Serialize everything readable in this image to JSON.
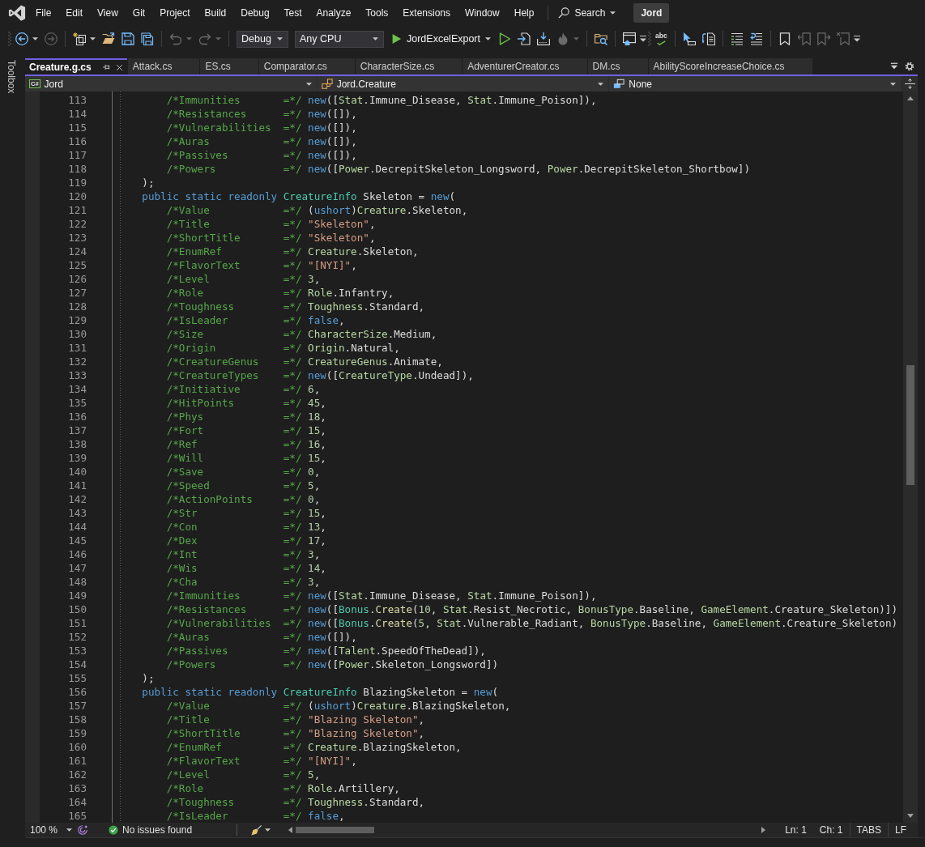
{
  "menu_bar": {
    "items": [
      "File",
      "Edit",
      "View",
      "Git",
      "Project",
      "Build",
      "Debug",
      "Test",
      "Analyze",
      "Tools",
      "Extensions",
      "Window",
      "Help"
    ],
    "search": {
      "label": "Search"
    },
    "solution": "Jord"
  },
  "toolbar": {
    "items": [
      {
        "kind": "grip"
      },
      {
        "kind": "split_button",
        "disabled": false
      },
      {
        "kind": "button",
        "disabled": true
      },
      {
        "kind": "separator"
      },
      {
        "kind": "split_button",
        "disabled": false
      },
      {
        "kind": "button",
        "disabled": false
      },
      {
        "kind": "button",
        "disabled": false
      },
      {
        "kind": "button",
        "disabled": false
      },
      {
        "kind": "separator"
      },
      {
        "kind": "split_button",
        "disabled": true
      },
      {
        "kind": "split_button",
        "disabled": true
      },
      {
        "kind": "separator"
      },
      {
        "kind": "dropdown",
        "value": "Debug"
      },
      {
        "kind": "dropdown",
        "value": "Any CPU"
      },
      {
        "kind": "run",
        "label": "JordExcelExport"
      },
      {
        "kind": "button",
        "disabled": false
      },
      {
        "kind": "button",
        "disabled": false
      },
      {
        "kind": "button",
        "disabled": false
      },
      {
        "kind": "split_button",
        "disabled": true
      },
      {
        "kind": "separator"
      },
      {
        "kind": "button",
        "disabled": false
      },
      {
        "kind": "separator"
      },
      {
        "kind": "button",
        "disabled": false
      },
      {
        "kind": "overflow"
      },
      {
        "kind": "grip"
      },
      {
        "kind": "text_button",
        "label": "abc"
      },
      {
        "kind": "separator"
      },
      {
        "kind": "button",
        "disabled": false
      },
      {
        "kind": "button",
        "disabled": false
      },
      {
        "kind": "separator"
      },
      {
        "kind": "button",
        "disabled": false
      },
      {
        "kind": "button",
        "disabled": false
      },
      {
        "kind": "separator"
      },
      {
        "kind": "button",
        "disabled": false
      },
      {
        "kind": "button",
        "disabled": true
      },
      {
        "kind": "button",
        "disabled": true
      },
      {
        "kind": "button",
        "disabled": true
      },
      {
        "kind": "overflow"
      }
    ]
  },
  "toolbox_tab": {
    "label": "Toolbox"
  },
  "tabs": [
    {
      "label": "Creature.g.cs",
      "selected": true
    },
    {
      "label": "Attack.cs",
      "selected": false
    },
    {
      "label": "ES.cs",
      "selected": false
    },
    {
      "label": "Comparator.cs",
      "selected": false
    },
    {
      "label": "CharacterSize.cs",
      "selected": false
    },
    {
      "label": "AdventurerCreator.cs",
      "selected": false
    },
    {
      "label": "DM.cs",
      "selected": false
    },
    {
      "label": "AbilityScoreIncreaseChoice.cs",
      "selected": false
    }
  ],
  "navigation": [
    {
      "icon_text": "C#",
      "value": "Jord"
    },
    {
      "value": "Jord.Creature"
    },
    {
      "value": "None"
    }
  ],
  "code": {
    "lines": [
      {
        "children": [
          {
            "number": "113",
            "tokens": [
              {
                "kind": "comment",
                "text": "/*Immunities       =*/ "
              },
              {
                "kind": "keyword",
                "text": "new"
              },
              {
                "kind": "plain",
                "text": "(["
              },
              {
                "kind": "enum",
                "text": "Stat"
              },
              {
                "kind": "plain",
                "text": ".Immune_Disease, "
              },
              {
                "kind": "enum",
                "text": "Stat"
              },
              {
                "kind": "plain",
                "text": ".Immune_Poison]),"
              }
            ]
          },
          {
            "number": "114",
            "tokens": [
              {
                "kind": "comment",
                "text": "/*Resistances      =*/ "
              },
              {
                "kind": "keyword",
                "text": "new"
              },
              {
                "kind": "plain",
                "text": "([]),"
              }
            ]
          },
          {
            "number": "115",
            "tokens": [
              {
                "kind": "comment",
                "text": "/*Vulnerabilities  =*/ "
              },
              {
                "kind": "keyword",
                "text": "new"
              },
              {
                "kind": "plain",
                "text": "([]),"
              }
            ]
          },
          {
            "number": "116",
            "tokens": [
              {
                "kind": "comment",
                "text": "/*Auras            =*/ "
              },
              {
                "kind": "keyword",
                "text": "new"
              },
              {
                "kind": "plain",
                "text": "([]),"
              }
            ]
          },
          {
            "number": "117",
            "tokens": [
              {
                "kind": "comment",
                "text": "/*Passives         =*/ "
              },
              {
                "kind": "keyword",
                "text": "new"
              },
              {
                "kind": "plain",
                "text": "([]),"
              }
            ]
          },
          {
            "number": "118",
            "tokens": [
              {
                "kind": "comment",
                "text": "/*Powers           =*/ "
              },
              {
                "kind": "keyword",
                "text": "new"
              },
              {
                "kind": "plain",
                "text": "(["
              },
              {
                "kind": "enum",
                "text": "Power"
              },
              {
                "kind": "plain",
                "text": ".DecrepitSkeleton_Longsword, "
              },
              {
                "kind": "enum",
                "text": "Power"
              },
              {
                "kind": "plain",
                "text": ".DecrepitSkeleton_Shortbow])"
              }
            ]
          }
        ]
      },
      {
        "number": "119",
        "tokens": [
          {
            "kind": "plain",
            "text": ");"
          }
        ]
      },
      {
        "number": "120",
        "tokens": [
          {
            "kind": "keyword",
            "text": "public static readonly "
          },
          {
            "kind": "class",
            "text": "CreatureInfo"
          },
          {
            "kind": "plain",
            "text": " Skeleton = "
          },
          {
            "kind": "keyword",
            "text": "new"
          },
          {
            "kind": "plain",
            "text": "("
          }
        ],
        "children": [
          {
            "number": "121",
            "tokens": [
              {
                "kind": "comment",
                "text": "/*Value            =*/ "
              },
              {
                "kind": "plain",
                "text": "("
              },
              {
                "kind": "keyword",
                "text": "ushort"
              },
              {
                "kind": "plain",
                "text": ")"
              },
              {
                "kind": "enum",
                "text": "Creature"
              },
              {
                "kind": "plain",
                "text": ".Skeleton,"
              }
            ]
          },
          {
            "number": "122",
            "tokens": [
              {
                "kind": "comment",
                "text": "/*Title            =*/ "
              },
              {
                "kind": "string",
                "text": "\"Skeleton\""
              },
              {
                "kind": "plain",
                "text": ","
              }
            ]
          },
          {
            "number": "123",
            "tokens": [
              {
                "kind": "comment",
                "text": "/*ShortTitle       =*/ "
              },
              {
                "kind": "string",
                "text": "\"Skeleton\""
              },
              {
                "kind": "plain",
                "text": ","
              }
            ]
          },
          {
            "number": "124",
            "tokens": [
              {
                "kind": "comment",
                "text": "/*EnumRef          =*/ "
              },
              {
                "kind": "enum",
                "text": "Creature"
              },
              {
                "kind": "plain",
                "text": ".Skeleton,"
              }
            ]
          },
          {
            "number": "125",
            "tokens": [
              {
                "kind": "comment",
                "text": "/*FlavorText       =*/ "
              },
              {
                "kind": "string",
                "text": "\"[NYI]\""
              },
              {
                "kind": "plain",
                "text": ","
              }
            ]
          },
          {
            "number": "126",
            "tokens": [
              {
                "kind": "comment",
                "text": "/*Level            =*/ "
              },
              {
                "kind": "number",
                "text": "3"
              },
              {
                "kind": "plain",
                "text": ","
              }
            ]
          },
          {
            "number": "127",
            "tokens": [
              {
                "kind": "comment",
                "text": "/*Role             =*/ "
              },
              {
                "kind": "enum",
                "text": "Role"
              },
              {
                "kind": "plain",
                "text": ".Infantry,"
              }
            ]
          },
          {
            "number": "128",
            "tokens": [
              {
                "kind": "comment",
                "text": "/*Toughness        =*/ "
              },
              {
                "kind": "enum",
                "text": "Toughness"
              },
              {
                "kind": "plain",
                "text": ".Standard,"
              }
            ]
          },
          {
            "number": "129",
            "tokens": [
              {
                "kind": "comment",
                "text": "/*IsLeader         =*/ "
              },
              {
                "kind": "keyword",
                "text": "false"
              },
              {
                "kind": "plain",
                "text": ","
              }
            ]
          },
          {
            "number": "130",
            "tokens": [
              {
                "kind": "comment",
                "text": "/*Size             =*/ "
              },
              {
                "kind": "enum",
                "text": "CharacterSize"
              },
              {
                "kind": "plain",
                "text": ".Medium,"
              }
            ]
          },
          {
            "number": "131",
            "tokens": [
              {
                "kind": "comment",
                "text": "/*Origin           =*/ "
              },
              {
                "kind": "enum",
                "text": "Origin"
              },
              {
                "kind": "plain",
                "text": ".Natural,"
              }
            ]
          },
          {
            "number": "132",
            "tokens": [
              {
                "kind": "comment",
                "text": "/*CreatureGenus    =*/ "
              },
              {
                "kind": "enum",
                "text": "CreatureGenus"
              },
              {
                "kind": "plain",
                "text": ".Animate,"
              }
            ]
          },
          {
            "number": "133",
            "tokens": [
              {
                "kind": "comment",
                "text": "/*CreatureTypes    =*/ "
              },
              {
                "kind": "keyword",
                "text": "new"
              },
              {
                "kind": "plain",
                "text": "(["
              },
              {
                "kind": "enum",
                "text": "CreatureType"
              },
              {
                "kind": "plain",
                "text": ".Undead]),"
              }
            ]
          },
          {
            "number": "134",
            "tokens": [
              {
                "kind": "comment",
                "text": "/*Initiative       =*/ "
              },
              {
                "kind": "number",
                "text": "6"
              },
              {
                "kind": "plain",
                "text": ","
              }
            ]
          },
          {
            "number": "135",
            "tokens": [
              {
                "kind": "comment",
                "text": "/*HitPoints        =*/ "
              },
              {
                "kind": "number",
                "text": "45"
              },
              {
                "kind": "plain",
                "text": ","
              }
            ]
          },
          {
            "number": "136",
            "tokens": [
              {
                "kind": "comment",
                "text": "/*Phys             =*/ "
              },
              {
                "kind": "number",
                "text": "18"
              },
              {
                "kind": "plain",
                "text": ","
              }
            ]
          },
          {
            "number": "137",
            "tokens": [
              {
                "kind": "comment",
                "text": "/*Fort             =*/ "
              },
              {
                "kind": "number",
                "text": "15"
              },
              {
                "kind": "plain",
                "text": ","
              }
            ]
          },
          {
            "number": "138",
            "tokens": [
              {
                "kind": "comment",
                "text": "/*Ref              =*/ "
              },
              {
                "kind": "number",
                "text": "16"
              },
              {
                "kind": "plain",
                "text": ","
              }
            ]
          },
          {
            "number": "139",
            "tokens": [
              {
                "kind": "comment",
                "text": "/*Will             =*/ "
              },
              {
                "kind": "number",
                "text": "15"
              },
              {
                "kind": "plain",
                "text": ","
              }
            ]
          },
          {
            "number": "140",
            "tokens": [
              {
                "kind": "comment",
                "text": "/*Save             =*/ "
              },
              {
                "kind": "number",
                "text": "0"
              },
              {
                "kind": "plain",
                "text": ","
              }
            ]
          },
          {
            "number": "141",
            "tokens": [
              {
                "kind": "comment",
                "text": "/*Speed            =*/ "
              },
              {
                "kind": "number",
                "text": "5"
              },
              {
                "kind": "plain",
                "text": ","
              }
            ]
          },
          {
            "number": "142",
            "tokens": [
              {
                "kind": "comment",
                "text": "/*ActionPoints     =*/ "
              },
              {
                "kind": "number",
                "text": "0"
              },
              {
                "kind": "plain",
                "text": ","
              }
            ]
          },
          {
            "number": "143",
            "tokens": [
              {
                "kind": "comment",
                "text": "/*Str              =*/ "
              },
              {
                "kind": "number",
                "text": "15"
              },
              {
                "kind": "plain",
                "text": ","
              }
            ]
          },
          {
            "number": "144",
            "tokens": [
              {
                "kind": "comment",
                "text": "/*Con              =*/ "
              },
              {
                "kind": "number",
                "text": "13"
              },
              {
                "kind": "plain",
                "text": ","
              }
            ]
          },
          {
            "number": "145",
            "tokens": [
              {
                "kind": "comment",
                "text": "/*Dex              =*/ "
              },
              {
                "kind": "number",
                "text": "17"
              },
              {
                "kind": "plain",
                "text": ","
              }
            ]
          },
          {
            "number": "146",
            "tokens": [
              {
                "kind": "comment",
                "text": "/*Int              =*/ "
              },
              {
                "kind": "number",
                "text": "3"
              },
              {
                "kind": "plain",
                "text": ","
              }
            ]
          },
          {
            "number": "147",
            "tokens": [
              {
                "kind": "comment",
                "text": "/*Wis              =*/ "
              },
              {
                "kind": "number",
                "text": "14"
              },
              {
                "kind": "plain",
                "text": ","
              }
            ]
          },
          {
            "number": "148",
            "tokens": [
              {
                "kind": "comment",
                "text": "/*Cha              =*/ "
              },
              {
                "kind": "number",
                "text": "3"
              },
              {
                "kind": "plain",
                "text": ","
              }
            ]
          },
          {
            "number": "149",
            "tokens": [
              {
                "kind": "comment",
                "text": "/*Immunities       =*/ "
              },
              {
                "kind": "keyword",
                "text": "new"
              },
              {
                "kind": "plain",
                "text": "(["
              },
              {
                "kind": "enum",
                "text": "Stat"
              },
              {
                "kind": "plain",
                "text": ".Immune_Disease, "
              },
              {
                "kind": "enum",
                "text": "Stat"
              },
              {
                "kind": "plain",
                "text": ".Immune_Poison]),"
              }
            ]
          },
          {
            "number": "150",
            "tokens": [
              {
                "kind": "comment",
                "text": "/*Resistances      =*/ "
              },
              {
                "kind": "keyword",
                "text": "new"
              },
              {
                "kind": "plain",
                "text": "(["
              },
              {
                "kind": "class",
                "text": "Bonus"
              },
              {
                "kind": "plain",
                "text": "."
              },
              {
                "kind": "method",
                "text": "Create"
              },
              {
                "kind": "plain",
                "text": "("
              },
              {
                "kind": "number",
                "text": "10"
              },
              {
                "kind": "plain",
                "text": ", "
              },
              {
                "kind": "enum",
                "text": "Stat"
              },
              {
                "kind": "plain",
                "text": ".Resist_Necrotic, "
              },
              {
                "kind": "enum",
                "text": "BonusType"
              },
              {
                "kind": "plain",
                "text": ".Baseline, "
              },
              {
                "kind": "enum",
                "text": "GameElement"
              },
              {
                "kind": "plain",
                "text": ".Creature_Skeleton)])"
              }
            ]
          },
          {
            "number": "151",
            "tokens": [
              {
                "kind": "comment",
                "text": "/*Vulnerabilities  =*/ "
              },
              {
                "kind": "keyword",
                "text": "new"
              },
              {
                "kind": "plain",
                "text": "(["
              },
              {
                "kind": "class",
                "text": "Bonus"
              },
              {
                "kind": "plain",
                "text": "."
              },
              {
                "kind": "method",
                "text": "Create"
              },
              {
                "kind": "plain",
                "text": "("
              },
              {
                "kind": "number",
                "text": "5"
              },
              {
                "kind": "plain",
                "text": ", "
              },
              {
                "kind": "enum",
                "text": "Stat"
              },
              {
                "kind": "plain",
                "text": ".Vulnerable_Radiant, "
              },
              {
                "kind": "enum",
                "text": "BonusType"
              },
              {
                "kind": "plain",
                "text": ".Baseline, "
              },
              {
                "kind": "enum",
                "text": "GameElement"
              },
              {
                "kind": "plain",
                "text": ".Creature_Skeleton)"
              }
            ]
          },
          {
            "number": "152",
            "tokens": [
              {
                "kind": "comment",
                "text": "/*Auras            =*/ "
              },
              {
                "kind": "keyword",
                "text": "new"
              },
              {
                "kind": "plain",
                "text": "([]),"
              }
            ]
          },
          {
            "number": "153",
            "tokens": [
              {
                "kind": "comment",
                "text": "/*Passives         =*/ "
              },
              {
                "kind": "keyword",
                "text": "new"
              },
              {
                "kind": "plain",
                "text": "(["
              },
              {
                "kind": "enum",
                "text": "Talent"
              },
              {
                "kind": "plain",
                "text": ".SpeedOfTheDead]),"
              }
            ]
          },
          {
            "number": "154",
            "tokens": [
              {
                "kind": "comment",
                "text": "/*Powers           =*/ "
              },
              {
                "kind": "keyword",
                "text": "new"
              },
              {
                "kind": "plain",
                "text": "(["
              },
              {
                "kind": "enum",
                "text": "Power"
              },
              {
                "kind": "plain",
                "text": ".Skeleton_Longsword])"
              }
            ]
          }
        ]
      },
      {
        "number": "155",
        "tokens": [
          {
            "kind": "plain",
            "text": ");"
          }
        ]
      },
      {
        "number": "156",
        "tokens": [
          {
            "kind": "keyword",
            "text": "public static readonly "
          },
          {
            "kind": "class",
            "text": "CreatureInfo"
          },
          {
            "kind": "plain",
            "text": " BlazingSkeleton = "
          },
          {
            "kind": "keyword",
            "text": "new"
          },
          {
            "kind": "plain",
            "text": "("
          }
        ],
        "children": [
          {
            "number": "157",
            "tokens": [
              {
                "kind": "comment",
                "text": "/*Value            =*/ "
              },
              {
                "kind": "plain",
                "text": "("
              },
              {
                "kind": "keyword",
                "text": "ushort"
              },
              {
                "kind": "plain",
                "text": ")"
              },
              {
                "kind": "enum",
                "text": "Creature"
              },
              {
                "kind": "plain",
                "text": ".BlazingSkeleton,"
              }
            ]
          },
          {
            "number": "158",
            "tokens": [
              {
                "kind": "comment",
                "text": "/*Title            =*/ "
              },
              {
                "kind": "string",
                "text": "\"Blazing Skeleton\""
              },
              {
                "kind": "plain",
                "text": ","
              }
            ]
          },
          {
            "number": "159",
            "tokens": [
              {
                "kind": "comment",
                "text": "/*ShortTitle       =*/ "
              },
              {
                "kind": "string",
                "text": "\"Blazing Skeleton\""
              },
              {
                "kind": "plain",
                "text": ","
              }
            ]
          },
          {
            "number": "160",
            "tokens": [
              {
                "kind": "comment",
                "text": "/*EnumRef          =*/ "
              },
              {
                "kind": "enum",
                "text": "Creature"
              },
              {
                "kind": "plain",
                "text": ".BlazingSkeleton,"
              }
            ]
          },
          {
            "number": "161",
            "tokens": [
              {
                "kind": "comment",
                "text": "/*FlavorText       =*/ "
              },
              {
                "kind": "string",
                "text": "\"[NYI]\""
              },
              {
                "kind": "plain",
                "text": ","
              }
            ]
          },
          {
            "number": "162",
            "tokens": [
              {
                "kind": "comment",
                "text": "/*Level            =*/ "
              },
              {
                "kind": "number",
                "text": "5"
              },
              {
                "kind": "plain",
                "text": ","
              }
            ]
          },
          {
            "number": "163",
            "tokens": [
              {
                "kind": "comment",
                "text": "/*Role             =*/ "
              },
              {
                "kind": "enum",
                "text": "Role"
              },
              {
                "kind": "plain",
                "text": ".Artillery,"
              }
            ]
          },
          {
            "number": "164",
            "tokens": [
              {
                "kind": "comment",
                "text": "/*Toughness        =*/ "
              },
              {
                "kind": "enum",
                "text": "Toughness"
              },
              {
                "kind": "plain",
                "text": ".Standard,"
              }
            ]
          },
          {
            "number": "165",
            "tokens": [
              {
                "kind": "comment",
                "text": "/*IsLeader         =*/ "
              },
              {
                "kind": "keyword",
                "text": "false"
              },
              {
                "kind": "plain",
                "text": ","
              }
            ]
          }
        ]
      }
    ]
  },
  "editor_status": {
    "zoom": "100 %",
    "issues": "No issues found",
    "line": "Ln: 1",
    "column": "Ch: 1",
    "indentation": "TABS",
    "line_ending": "LF"
  }
}
